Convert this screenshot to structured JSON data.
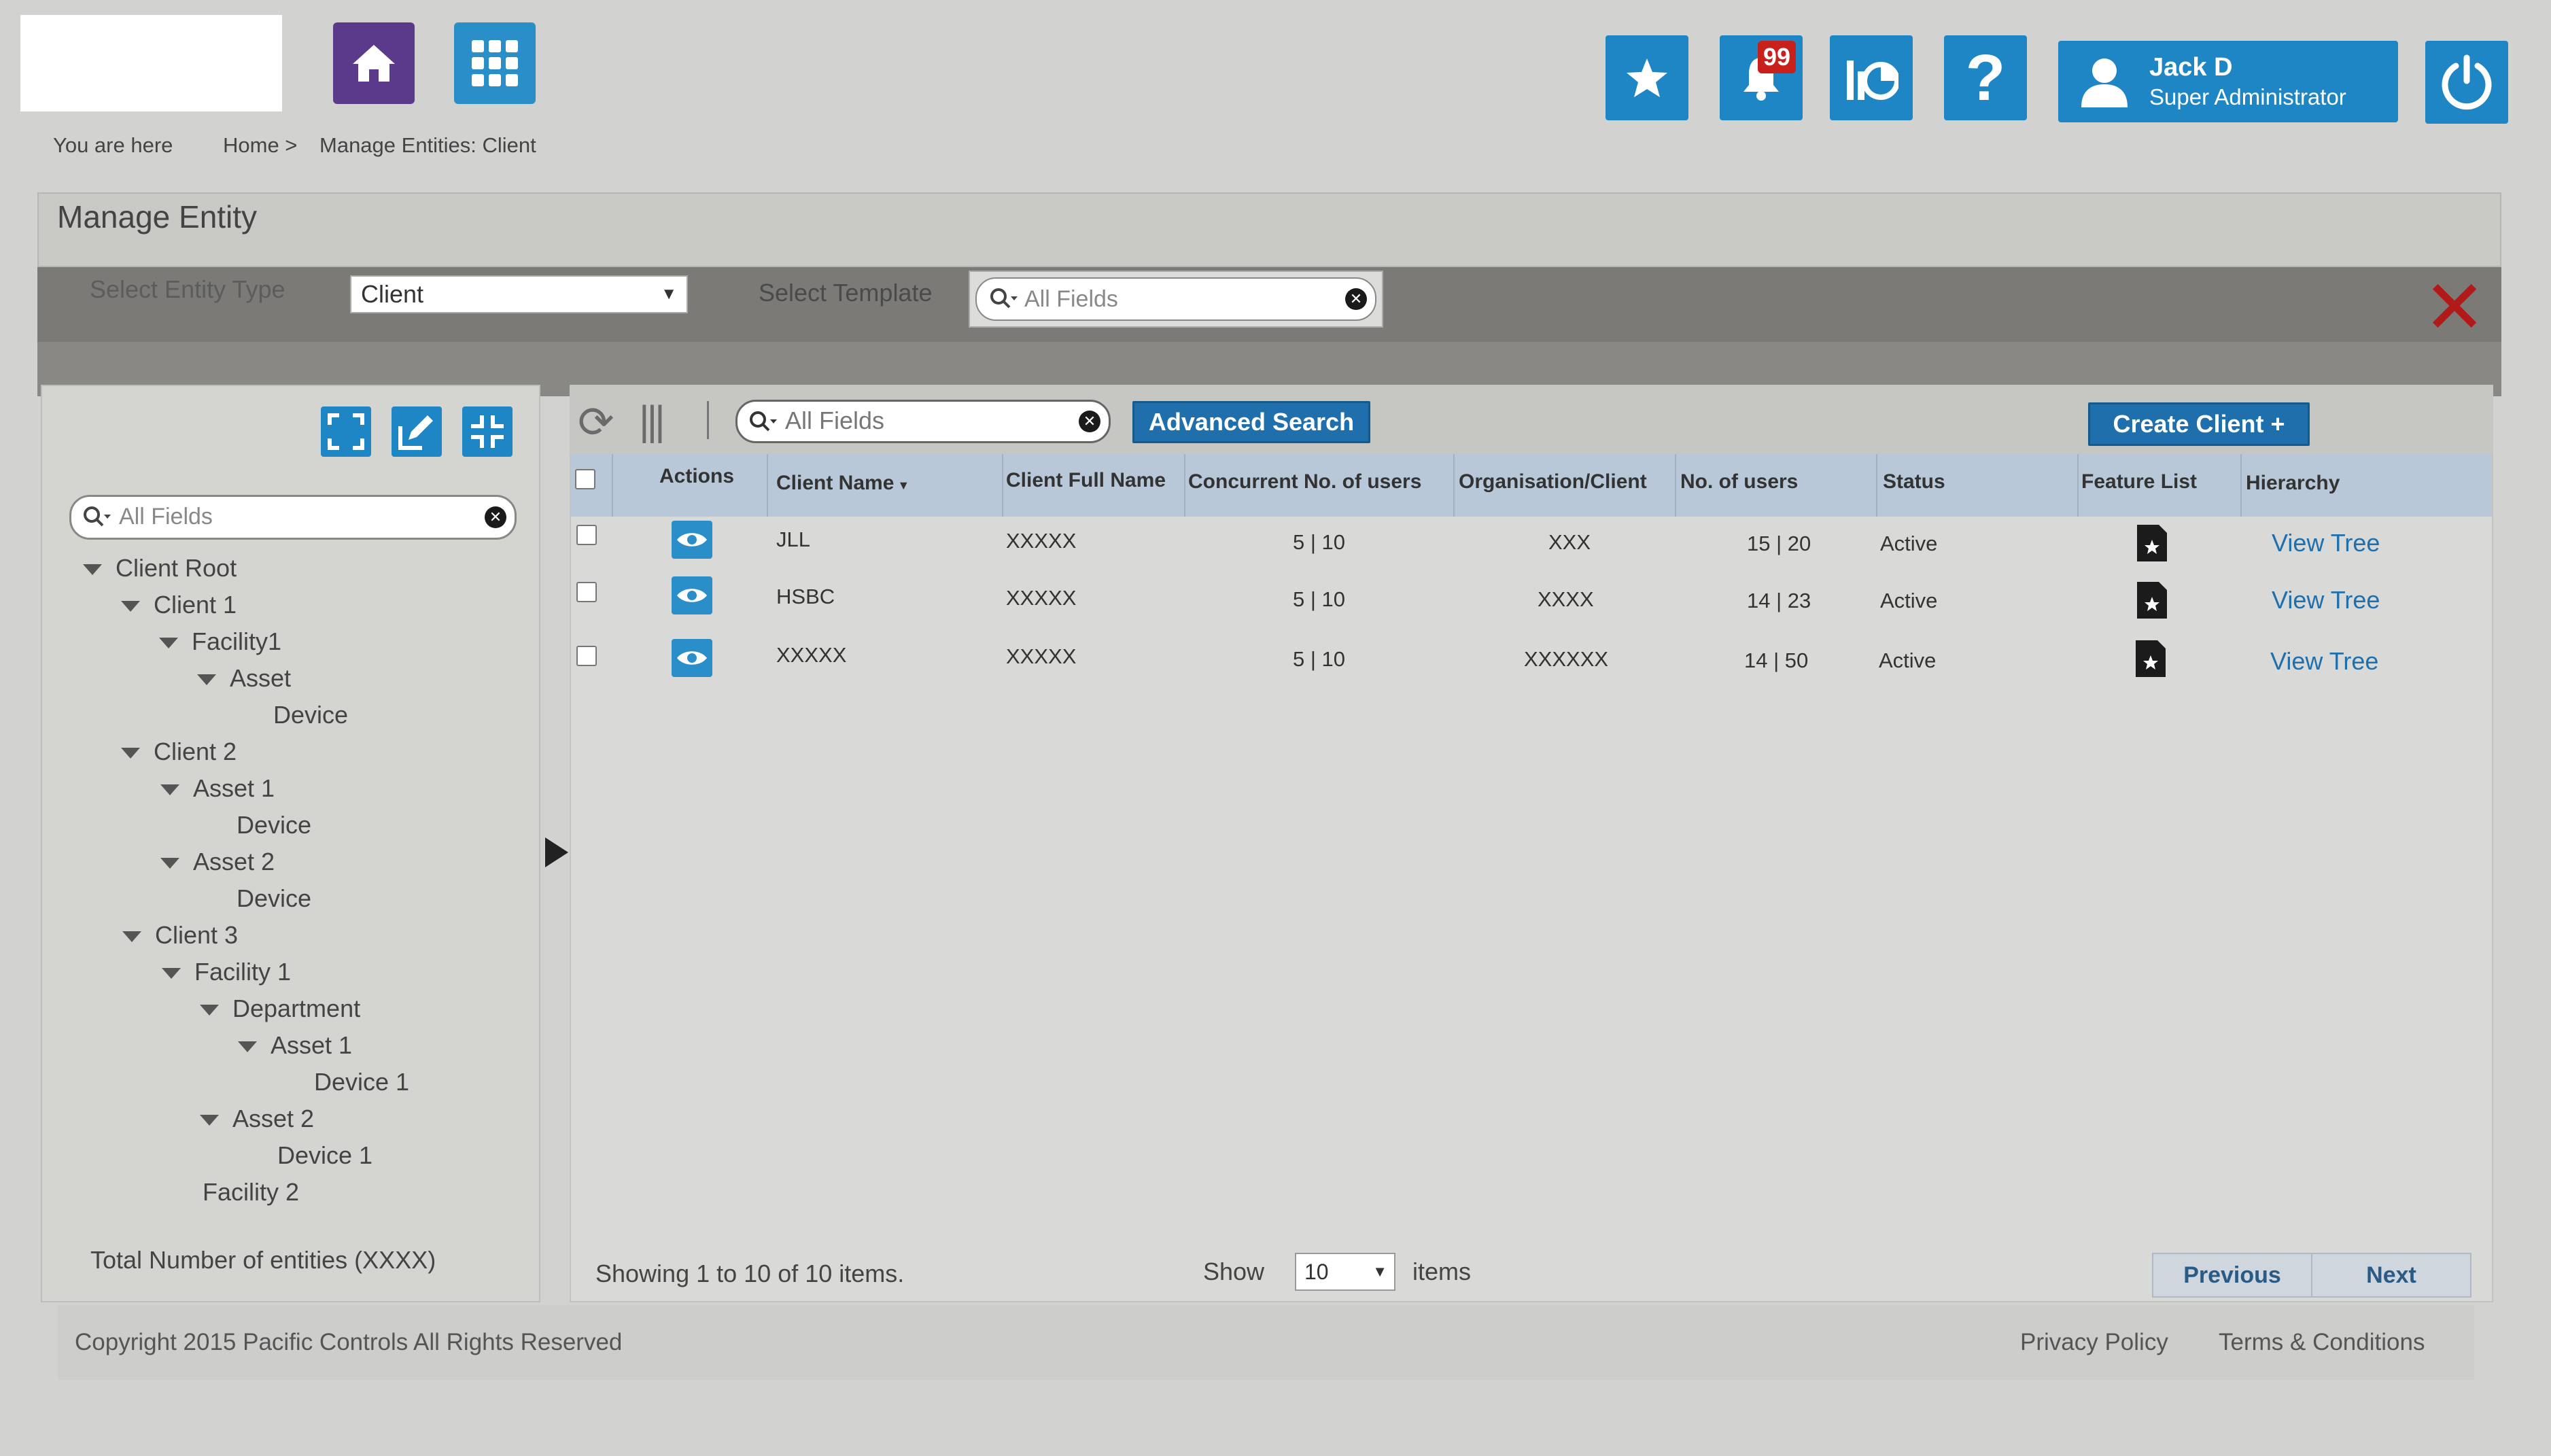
{
  "header": {
    "notification_count": "99",
    "user_name": "Jack D",
    "user_role": "Super Administrator"
  },
  "breadcrumb": {
    "you_are_here": "You are here",
    "home": "Home >",
    "current": "Manage Entities: Client"
  },
  "page": {
    "title": "Manage  Entity",
    "entity_type_label": "Select Entity Type",
    "entity_type_value": "Client",
    "template_label": "Select Template",
    "template_placeholder": "All Fields"
  },
  "tree": {
    "search_placeholder": "All Fields",
    "nodes": [
      {
        "label": "Client Root",
        "expanded": true
      },
      {
        "label": "Client 1",
        "expanded": true
      },
      {
        "label": "Facility1",
        "expanded": true
      },
      {
        "label": "Asset",
        "expanded": true
      },
      {
        "label": "Device",
        "expanded": false
      },
      {
        "label": "Client 2",
        "expanded": true
      },
      {
        "label": "Asset 1",
        "expanded": true
      },
      {
        "label": "Device",
        "expanded": false
      },
      {
        "label": "Asset 2",
        "expanded": true
      },
      {
        "label": "Device",
        "expanded": false
      },
      {
        "label": "Client 3",
        "expanded": true
      },
      {
        "label": "Facility 1",
        "expanded": true
      },
      {
        "label": "Department",
        "expanded": true
      },
      {
        "label": "Asset 1",
        "expanded": true
      },
      {
        "label": "Device 1",
        "expanded": false
      },
      {
        "label": "Asset 2",
        "expanded": true
      },
      {
        "label": "Device 1",
        "expanded": false
      },
      {
        "label": "Facility 2",
        "expanded": false
      }
    ],
    "total": "Total Number of entities (XXXX)"
  },
  "grid": {
    "search_placeholder": "All Fields",
    "advanced_search": "Advanced Search",
    "create_button": "Create Client +",
    "columns": [
      "Actions",
      "Client Name",
      "Client Full Name",
      "Concurrent No. of users",
      "Organisation/Client",
      "No. of users",
      "Status",
      "Feature List",
      "Hierarchy"
    ],
    "rows": [
      {
        "client_name": "JLL",
        "full_name": "XXXXX",
        "concurrent": "5 | 10",
        "org": "XXX",
        "users": "15 | 20",
        "status": "Active",
        "hierarchy": "View Tree"
      },
      {
        "client_name": "HSBC",
        "full_name": "XXXXX",
        "concurrent": "5 | 10",
        "org": "XXXX",
        "users": "14 | 23",
        "status": "Active",
        "hierarchy": "View Tree"
      },
      {
        "client_name": "XXXXX",
        "full_name": "XXXXX",
        "concurrent": "5 | 10",
        "org": "XXXXXX",
        "users": "14 | 50",
        "status": "Active",
        "hierarchy": "View Tree"
      }
    ],
    "showing": "Showing 1 to 10 of 10 items.",
    "show_label": "Show",
    "page_size": "10",
    "items_label": "items",
    "previous": "Previous",
    "next": "Next"
  },
  "footer": {
    "copyright": "Copyright  2015 Pacific Controls  All Rights Reserved",
    "privacy": "Privacy Policy",
    "terms": "Terms & Conditions"
  },
  "colors": {
    "primary_blue": "#1f86c6",
    "home_purple": "#5b3a8c",
    "close_red": "#b21a1a",
    "badge_red": "#c8211c"
  }
}
